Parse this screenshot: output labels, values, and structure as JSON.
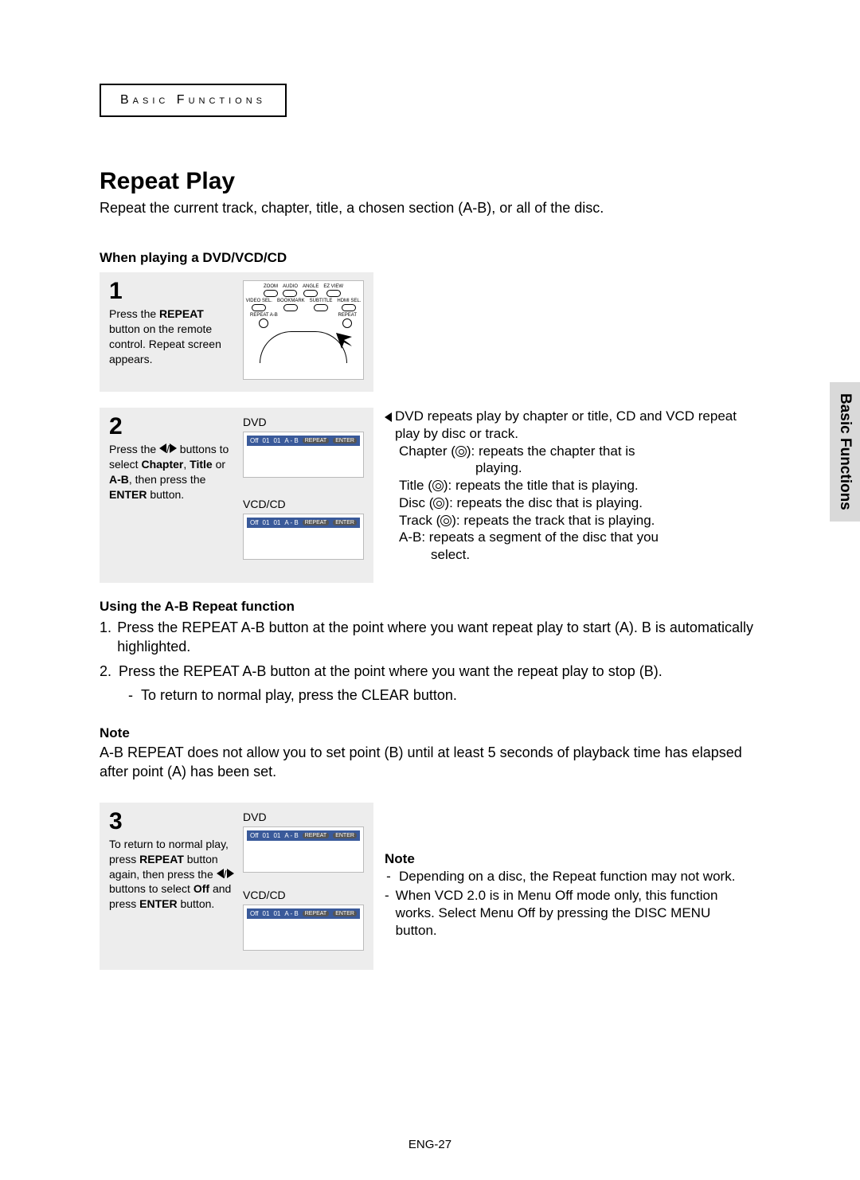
{
  "header": {
    "chapter_label": "Basic Functions"
  },
  "title": "Repeat Play",
  "intro": "Repeat the current track, chapter, title, a chosen section (A-B), or all of the disc.",
  "subhead1": "When playing a DVD/VCD/CD",
  "step1": {
    "num": "1",
    "text_before": "Press the ",
    "bold1": "REPEAT",
    "text_mid": " button on the remote control. Repeat screen appears.",
    "remote_labels_row1": [
      "ZOOM",
      "AUDIO",
      "ANGLE",
      "EZ VIEW"
    ],
    "remote_labels_row2": [
      "VIDEO SEL.",
      "BOOKMARK",
      "SUBTITLE",
      "HDMI SEL."
    ],
    "remote_labels_row3_left": "REPEAT A-B",
    "remote_labels_row3_right": "REPEAT"
  },
  "step2": {
    "num": "2",
    "text_a": "Press the ",
    "text_b": " buttons to select ",
    "bold_chapter": "Chapter",
    "bold_title": "Title",
    "bold_ab": "A-B",
    "text_c": ", then press the ",
    "bold_enter": "ENTER",
    "text_d": " button.",
    "dvd_label": "DVD",
    "vcd_label": "VCD/CD",
    "osd_items_dvd": [
      "Off",
      "01",
      "01",
      "A - B",
      "REPEAT",
      "ENTER"
    ],
    "osd_items_vcd": [
      "Off",
      "01",
      "01",
      "A - B",
      "REPEAT",
      "ENTER"
    ]
  },
  "right2": {
    "lead": "DVD repeats play by chapter or title, CD and VCD repeat play by disc or track.",
    "chapter": "Chapter (",
    "chapter_tail": "): repeats the chapter that is",
    "chapter_tail2": "playing.",
    "title": "Title (",
    "title_tail": "): repeats the title that is playing.",
    "disc": "Disc (",
    "disc_tail": "): repeats the disc that is playing.",
    "track": "Track (",
    "track_tail": "): repeats the track that is playing.",
    "ab": "A-B: repeats a segment of the disc that you",
    "ab2": "select."
  },
  "ab_section": {
    "head": "Using the A-B Repeat function",
    "item1": "Press the REPEAT A-B button at the point where you want repeat play to start (A). B is automatically highlighted.",
    "item2": "Press the REPEAT A-B button at the point where you want the repeat play to stop (B).",
    "sub": "To return to normal play, press the CLEAR button."
  },
  "note1": {
    "head": "Note",
    "body": "A-B REPEAT does not allow you to set point (B) until at least 5 seconds of playback time has elapsed after point (A) has been set."
  },
  "step3": {
    "num": "3",
    "text_a": "To return to normal play, press ",
    "bold_repeat": "REPEAT",
    "text_b": " button again, then press the ",
    "text_c": " buttons to select ",
    "bold_off": "Off",
    "text_d": " and press ",
    "bold_enter": "ENTER",
    "text_e": " button.",
    "dvd_label": "DVD",
    "vcd_label": "VCD/CD",
    "osd_items": [
      "Off",
      "01",
      "01",
      "A - B",
      "REPEAT",
      "ENTER"
    ]
  },
  "note2": {
    "head": "Note",
    "d1": "Depending on a disc, the Repeat function may not work.",
    "d2": "When VCD 2.0 is in Menu Off mode only, this function works. Select Menu Off by pressing the DISC MENU button."
  },
  "side_tab": "Basic Functions",
  "footer": "ENG-27"
}
